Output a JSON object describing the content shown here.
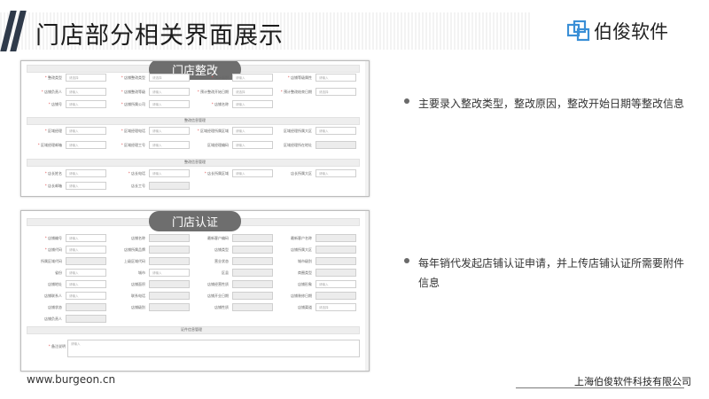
{
  "header": {
    "title": "门店部分相关界面展示"
  },
  "logo": {
    "name": "伯俊软件",
    "icon": "logo-squares-icon",
    "color": "#3a8fd6"
  },
  "panel_rectify": {
    "title": "门店整改",
    "sections": [
      {
        "label": "整改信息管理"
      },
      {
        "label": "整改信息管理"
      }
    ],
    "rows": [
      [
        {
          "label": "整改类型",
          "req": true,
          "value": "请选择"
        },
        {
          "label": "店铺整改类型",
          "req": true,
          "value": "请选择"
        },
        {
          "label": "预计面积",
          "req": true,
          "value": "请输入"
        },
        {
          "label": "店铺等级属性",
          "req": true,
          "value": "请输入"
        }
      ],
      [
        {
          "label": "店铺负责人",
          "req": true,
          "value": "请输入"
        },
        {
          "label": "店铺整改等级",
          "req": true,
          "value": "请输入"
        },
        {
          "label": "预计整改开始日期",
          "req": true,
          "value": "请选择"
        },
        {
          "label": "预计整改结束日期",
          "req": true,
          "value": "请选择"
        }
      ],
      [
        {
          "label": "店铺号",
          "req": true,
          "value": "请输入"
        },
        {
          "label": "店铺所属公司",
          "req": true,
          "value": "请输入"
        },
        {
          "label": "店铺名称",
          "req": true,
          "value": "请输入"
        },
        {
          "label": "",
          "req": false,
          "value": ""
        }
      ],
      [
        {
          "label": "区域经理",
          "req": true,
          "value": "请输入"
        },
        {
          "label": "区域经理电话",
          "req": true,
          "value": "请输入"
        },
        {
          "label": "区域经理所属区域",
          "req": true,
          "value": "请输入"
        },
        {
          "label": "区域经理所属大区",
          "req": false,
          "value": "请输入"
        }
      ],
      [
        {
          "label": "区域经理邮箱",
          "req": true,
          "value": "请输入"
        },
        {
          "label": "区域经理工号",
          "req": true,
          "value": "请输入"
        },
        {
          "label": "区域经理编码",
          "req": false,
          "value": "请输入"
        },
        {
          "label": "区域经理所在地址",
          "req": false,
          "value": ""
        }
      ],
      [
        {
          "label": "店长姓名",
          "req": true,
          "value": "请输入"
        },
        {
          "label": "店长电话",
          "req": true,
          "value": "请输入"
        },
        {
          "label": "店长所属区域",
          "req": true,
          "value": "请输入"
        },
        {
          "label": "店长所属大区",
          "req": false,
          "value": "请输入"
        }
      ],
      [
        {
          "label": "店长邮箱",
          "req": true,
          "value": "请输入"
        },
        {
          "label": "店长工号",
          "req": false,
          "value": ""
        },
        {
          "label": "",
          "req": false,
          "value": ""
        },
        {
          "label": "",
          "req": false,
          "value": ""
        }
      ]
    ]
  },
  "panel_certify": {
    "title": "门店认证",
    "section_label": "证件信息管理",
    "remark": {
      "label": "备注说明",
      "placeholder": "请输入"
    },
    "rows": [
      [
        {
          "label": "店铺编号",
          "req": true,
          "value": "请输入"
        },
        {
          "label": "店铺名称",
          "req": false,
          "value": ""
        },
        {
          "label": "最新客户编码",
          "req": false,
          "value": ""
        },
        {
          "label": "最新客户名称",
          "req": false,
          "value": ""
        }
      ],
      [
        {
          "label": "店铺代码",
          "req": true,
          "value": "请输入"
        },
        {
          "label": "店铺所属品牌",
          "req": false,
          "value": ""
        },
        {
          "label": "店铺类型",
          "req": false,
          "value": ""
        },
        {
          "label": "店铺所属大区",
          "req": false,
          "value": ""
        }
      ],
      [
        {
          "label": "所属区域代码",
          "req": false,
          "value": ""
        },
        {
          "label": "上级区域代码",
          "req": false,
          "value": ""
        },
        {
          "label": "营业状态",
          "req": false,
          "value": ""
        },
        {
          "label": "城市级别",
          "req": false,
          "value": ""
        }
      ],
      [
        {
          "label": "省份",
          "req": false,
          "value": "请输入"
        },
        {
          "label": "城市",
          "req": false,
          "value": "请输入"
        },
        {
          "label": "区县",
          "req": false,
          "value": ""
        },
        {
          "label": "商圈类型",
          "req": false,
          "value": ""
        }
      ],
      [
        {
          "label": "店铺地址",
          "req": false,
          "value": "请输入"
        },
        {
          "label": "店铺面积",
          "req": false,
          "value": ""
        },
        {
          "label": "店铺经营性质",
          "req": false,
          "value": ""
        },
        {
          "label": "店铺形象",
          "req": false,
          "value": "请输入"
        }
      ],
      [
        {
          "label": "店铺联系人",
          "req": false,
          "value": "请输入"
        },
        {
          "label": "联系电话",
          "req": false,
          "value": ""
        },
        {
          "label": "店铺开业日期",
          "req": false,
          "value": ""
        },
        {
          "label": "店铺装修日期",
          "req": false,
          "value": ""
        }
      ],
      [
        {
          "label": "店铺状态",
          "req": false,
          "value": ""
        },
        {
          "label": "店铺级别",
          "req": false,
          "value": ""
        },
        {
          "label": "店铺性质",
          "req": false,
          "value": ""
        },
        {
          "label": "店铺渠道",
          "req": false,
          "value": "请选择"
        }
      ],
      [
        {
          "label": "店铺负责人",
          "req": false,
          "value": ""
        },
        {
          "label": "",
          "req": false,
          "value": ""
        },
        {
          "label": "",
          "req": false,
          "value": ""
        },
        {
          "label": "",
          "req": false,
          "value": ""
        }
      ]
    ]
  },
  "bullets": [
    {
      "text": "主要录入整改类型，整改原因，整改开始日期等整改信息"
    },
    {
      "line1": "每年销代发起店铺认证申请，并上传店铺认证所需要附件",
      "line2": "信息"
    }
  ],
  "footer": {
    "url": "www.burgeon.cn",
    "company": "上海伯俊软件科技有限公司"
  }
}
